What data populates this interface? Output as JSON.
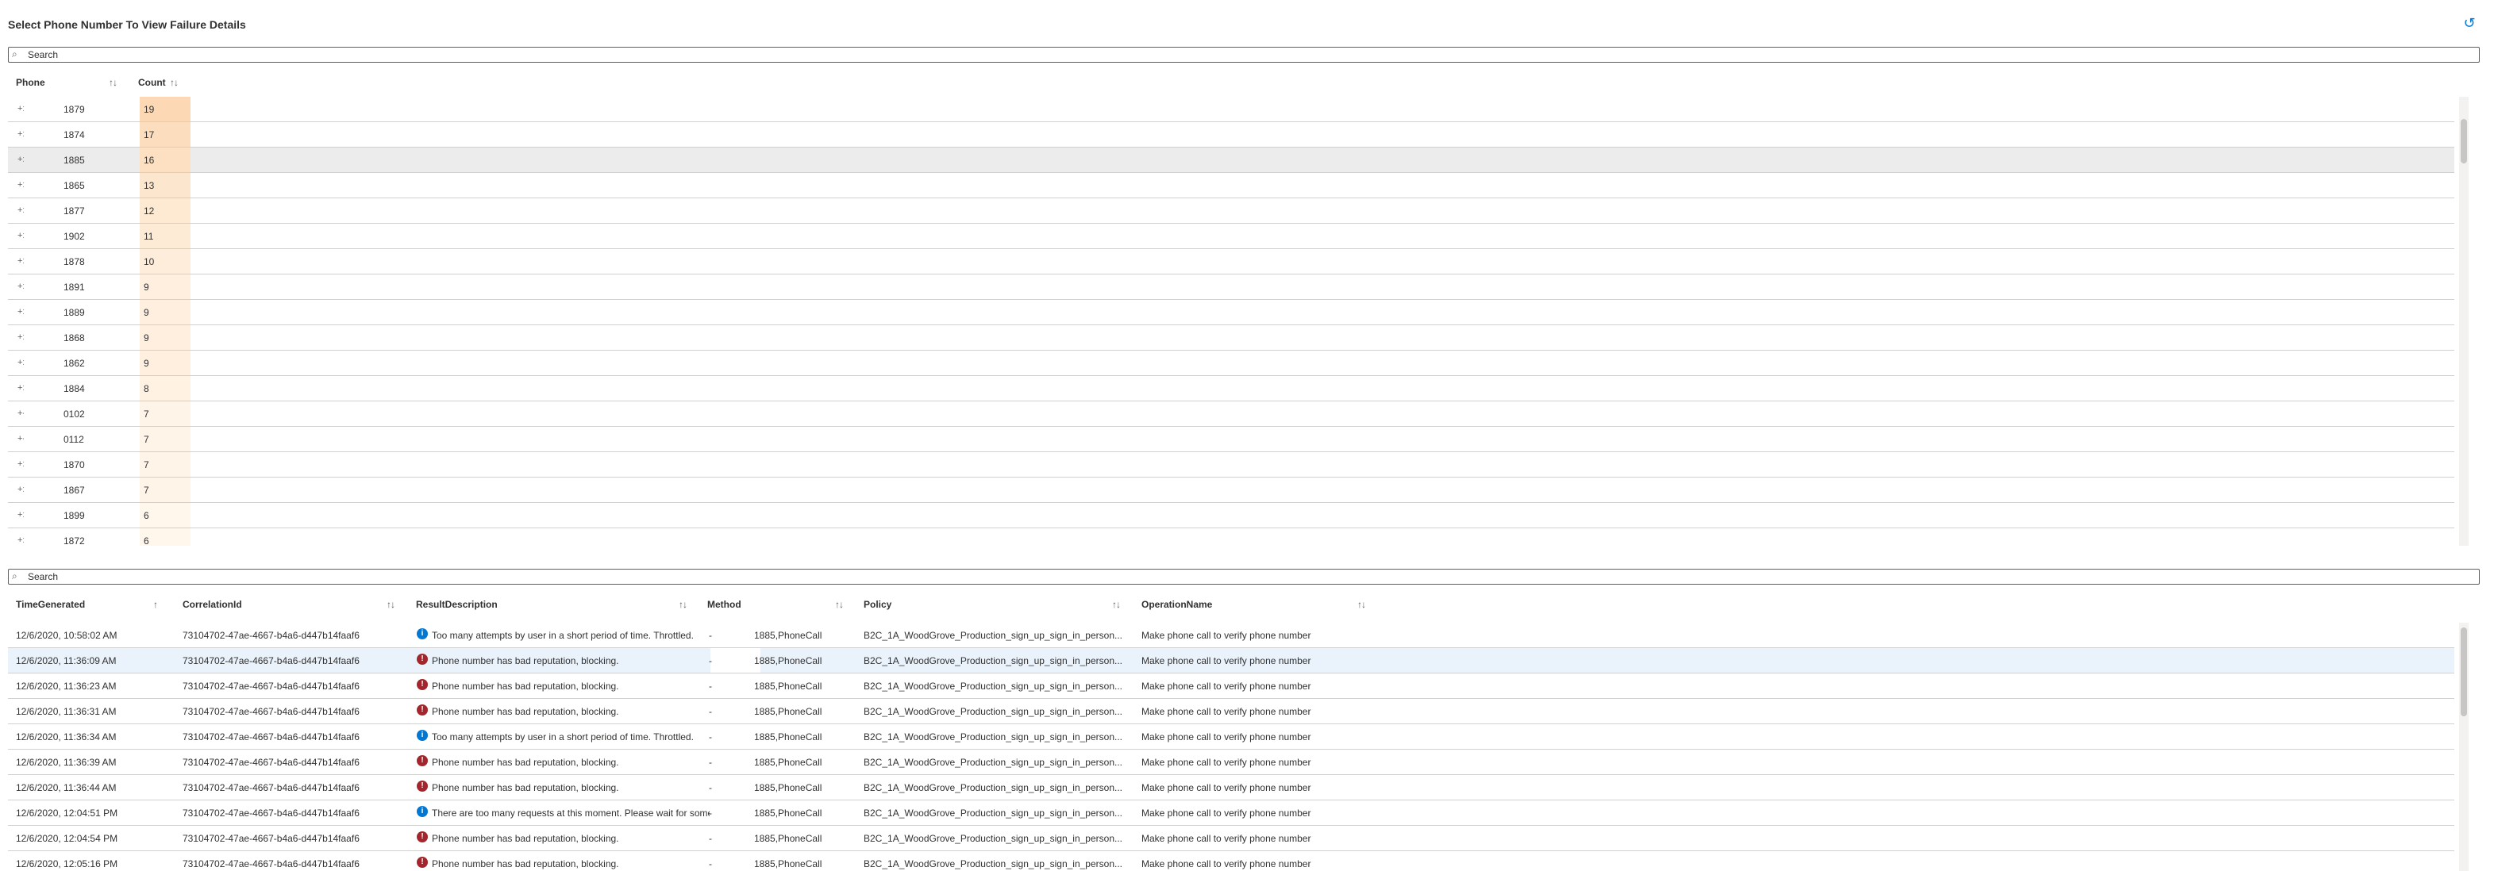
{
  "page": {
    "title": "Select Phone Number To View Failure Details",
    "undo_icon": "undo-icon"
  },
  "phone_search": {
    "placeholder": "Search"
  },
  "phone_table": {
    "columns": {
      "phone": "Phone",
      "count": "Count"
    },
    "rows": [
      {
        "prefix": "+:",
        "number": "1879",
        "count": "19"
      },
      {
        "prefix": "+:",
        "number": "1874",
        "count": "17"
      },
      {
        "prefix": "+:",
        "number": "1885",
        "count": "16"
      },
      {
        "prefix": "+:",
        "number": "1865",
        "count": "13"
      },
      {
        "prefix": "+:",
        "number": "1877",
        "count": "12"
      },
      {
        "prefix": "+:",
        "number": "1902",
        "count": "11"
      },
      {
        "prefix": "+:",
        "number": "1878",
        "count": "10"
      },
      {
        "prefix": "+:",
        "number": "1891",
        "count": "9"
      },
      {
        "prefix": "+:",
        "number": "1889",
        "count": "9"
      },
      {
        "prefix": "+:",
        "number": "1868",
        "count": "9"
      },
      {
        "prefix": "+:",
        "number": "1862",
        "count": "9"
      },
      {
        "prefix": "+:",
        "number": "1884",
        "count": "8"
      },
      {
        "prefix": "+-",
        "number": "0102",
        "count": "7"
      },
      {
        "prefix": "+-",
        "number": "0112",
        "count": "7"
      },
      {
        "prefix": "+:",
        "number": "1870",
        "count": "7"
      },
      {
        "prefix": "+:",
        "number": "1867",
        "count": "7"
      },
      {
        "prefix": "+:",
        "number": "1899",
        "count": "6"
      },
      {
        "prefix": "+:",
        "number": "1872",
        "count": "6"
      }
    ]
  },
  "detail_search": {
    "placeholder": "Search"
  },
  "detail_table": {
    "columns": {
      "time": "TimeGenerated",
      "corr": "CorrelationId",
      "desc": "ResultDescription",
      "method": "Method",
      "policy": "Policy",
      "op": "OperationName"
    },
    "rows": [
      {
        "time": "12/6/2020, 10:58:02 AM",
        "corr": "73104702-47ae-4667-b4a6-d447b14faaf6",
        "icon": "info-icon",
        "desc": "Too many attempts by user in a short period of time. Throttled.",
        "dash": "-",
        "method": "1885,PhoneCall",
        "policy": "B2C_1A_WoodGrove_Production_sign_up_sign_in_person...",
        "op": "Make phone call to verify phone number"
      },
      {
        "time": "12/6/2020, 11:36:09 AM",
        "corr": "73104702-47ae-4667-b4a6-d447b14faaf6",
        "icon": "error-icon",
        "desc": "Phone number has bad reputation, blocking.",
        "dash": "-",
        "method": "1885,PhoneCall",
        "policy": "B2C_1A_WoodGrove_Production_sign_up_sign_in_person...",
        "op": "Make phone call to verify phone number"
      },
      {
        "time": "12/6/2020, 11:36:23 AM",
        "corr": "73104702-47ae-4667-b4a6-d447b14faaf6",
        "icon": "error-icon",
        "desc": "Phone number has bad reputation, blocking.",
        "dash": "-",
        "method": "1885,PhoneCall",
        "policy": "B2C_1A_WoodGrove_Production_sign_up_sign_in_person...",
        "op": "Make phone call to verify phone number"
      },
      {
        "time": "12/6/2020, 11:36:31 AM",
        "corr": "73104702-47ae-4667-b4a6-d447b14faaf6",
        "icon": "error-icon",
        "desc": "Phone number has bad reputation, blocking.",
        "dash": "-",
        "method": "1885,PhoneCall",
        "policy": "B2C_1A_WoodGrove_Production_sign_up_sign_in_person...",
        "op": "Make phone call to verify phone number"
      },
      {
        "time": "12/6/2020, 11:36:34 AM",
        "corr": "73104702-47ae-4667-b4a6-d447b14faaf6",
        "icon": "info-icon",
        "desc": "Too many attempts by user in a short period of time. Throttled.",
        "dash": "-",
        "method": "1885,PhoneCall",
        "policy": "B2C_1A_WoodGrove_Production_sign_up_sign_in_person...",
        "op": "Make phone call to verify phone number"
      },
      {
        "time": "12/6/2020, 11:36:39 AM",
        "corr": "73104702-47ae-4667-b4a6-d447b14faaf6",
        "icon": "error-icon",
        "desc": "Phone number has bad reputation, blocking.",
        "dash": "-",
        "method": "1885,PhoneCall",
        "policy": "B2C_1A_WoodGrove_Production_sign_up_sign_in_person...",
        "op": "Make phone call to verify phone number"
      },
      {
        "time": "12/6/2020, 11:36:44 AM",
        "corr": "73104702-47ae-4667-b4a6-d447b14faaf6",
        "icon": "error-icon",
        "desc": "Phone number has bad reputation, blocking.",
        "dash": "-",
        "method": "1885,PhoneCall",
        "policy": "B2C_1A_WoodGrove_Production_sign_up_sign_in_person...",
        "op": "Make phone call to verify phone number"
      },
      {
        "time": "12/6/2020, 12:04:51 PM",
        "corr": "73104702-47ae-4667-b4a6-d447b14faaf6",
        "icon": "info-icon",
        "desc": "There are too many requests at this moment. Please wait for some time.",
        "dash": "-",
        "method": "1885,PhoneCall",
        "policy": "B2C_1A_WoodGrove_Production_sign_up_sign_in_person...",
        "op": "Make phone call to verify phone number"
      },
      {
        "time": "12/6/2020, 12:04:54 PM",
        "corr": "73104702-47ae-4667-b4a6-d447b14faaf6",
        "icon": "error-icon",
        "desc": "Phone number has bad reputation, blocking.",
        "dash": "-",
        "method": "1885,PhoneCall",
        "policy": "B2C_1A_WoodGrove_Production_sign_up_sign_in_person...",
        "op": "Make phone call to verify phone number"
      },
      {
        "time": "12/6/2020, 12:05:16 PM",
        "corr": "73104702-47ae-4667-b4a6-d447b14faaf6",
        "icon": "error-icon",
        "desc": "Phone number has bad reputation, blocking.",
        "dash": "-",
        "method": "1885,PhoneCall",
        "policy": "B2C_1A_WoodGrove_Production_sign_up_sign_in_person...",
        "op": "Make phone call to verify phone number"
      }
    ]
  },
  "colors": {
    "accent": "#0078d4",
    "error": "#a4262c",
    "count_heat_max": "#fcd9b4",
    "count_heat_min": "#fff6ec"
  }
}
